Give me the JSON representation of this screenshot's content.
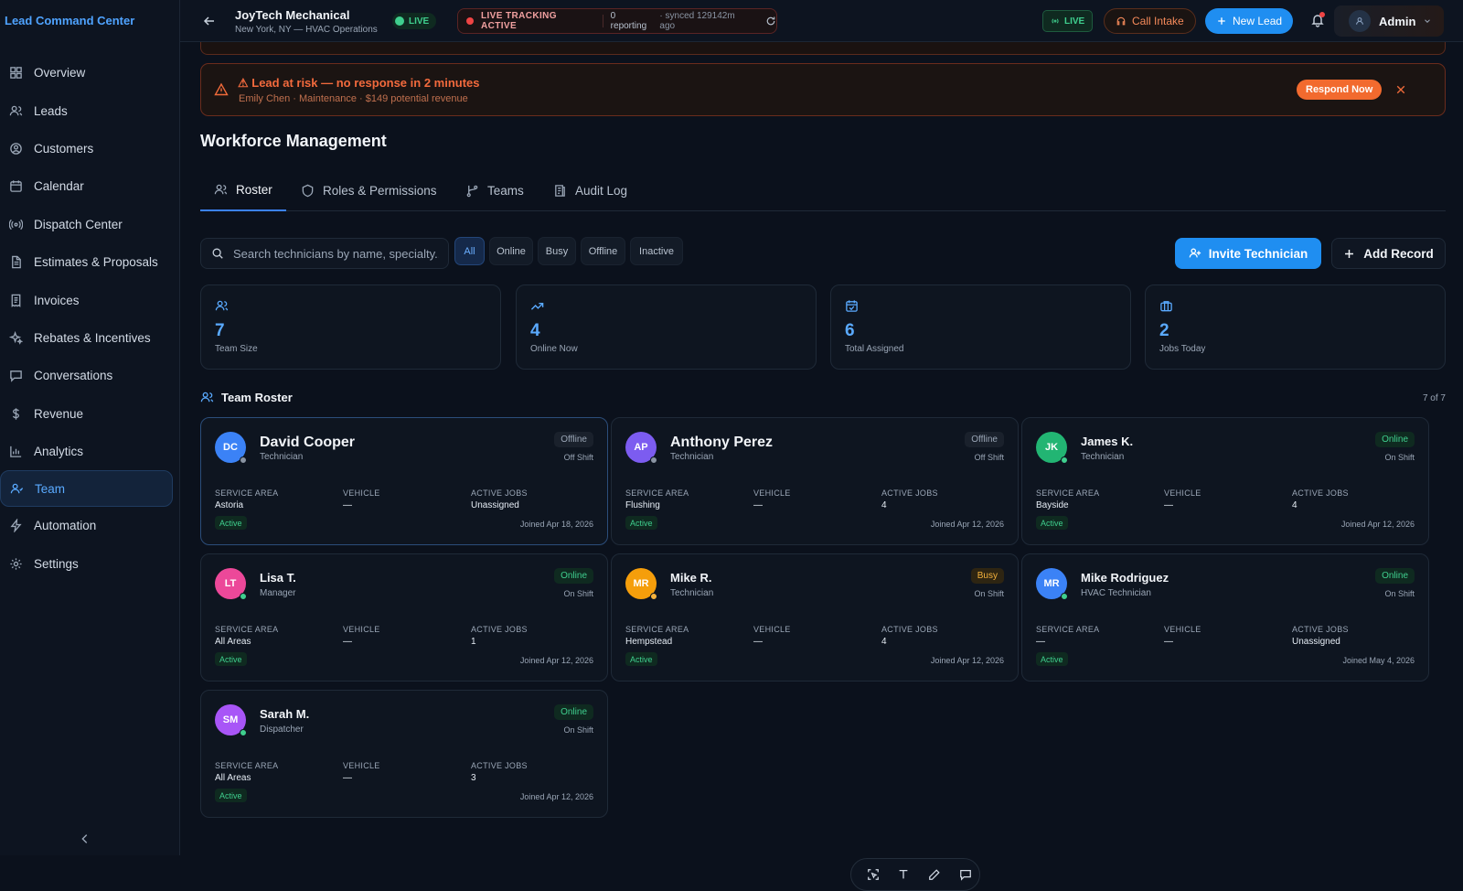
{
  "brand": "Lead Command Center",
  "nav": [
    "Overview",
    "Leads",
    "Customers",
    "Calendar",
    "Dispatch Center",
    "Estimates & Proposals",
    "Invoices",
    "Rebates & Incentives",
    "Conversations",
    "Revenue",
    "Analytics",
    "Team",
    "Automation",
    "Settings"
  ],
  "nav_icons": [
    "grid-icon",
    "users-icon",
    "user-circle-icon",
    "calendar-icon",
    "radio-icon",
    "document-icon",
    "receipt-icon",
    "sparkles-icon",
    "chat-icon",
    "dollar-icon",
    "bar-chart-icon",
    "team-icon",
    "bolt-icon",
    "gear-icon"
  ],
  "nav_active": "Team",
  "topbar": {
    "company": "JoyTech Mechanical",
    "location": "New York, NY — HVAC Operations",
    "live": "LIVE",
    "tracking": "LIVE TRACKING ACTIVE",
    "reporting": "0 reporting",
    "synced": "· synced 129142m ago",
    "live2": "LIVE",
    "call_intake": "Call Intake",
    "new_lead": "New Lead",
    "user": "Admin"
  },
  "alert": {
    "title": "⚠ Lead at risk — no response in 2 minutes",
    "detail": "Emily Chen · Maintenance · $149 potential revenue",
    "action": "Respond Now"
  },
  "page_title": "Workforce Management",
  "tabs": [
    "Roster",
    "Roles & Permissions",
    "Teams",
    "Audit Log"
  ],
  "search_placeholder": "Search technicians by name, specialty...",
  "filters": [
    "All",
    "Online",
    "Busy",
    "Offline",
    "Inactive"
  ],
  "invite_label": "Invite Technician",
  "add_label": "Add Record",
  "stats": [
    {
      "value": "7",
      "label": "Team Size",
      "icon": "users-icon"
    },
    {
      "value": "4",
      "label": "Online Now",
      "icon": "trending-up-icon"
    },
    {
      "value": "6",
      "label": "Total Assigned",
      "icon": "calendar-check-icon"
    },
    {
      "value": "2",
      "label": "Jobs Today",
      "icon": "briefcase-icon"
    }
  ],
  "roster_title": "Team Roster",
  "roster_count": "7 of 7",
  "field_labels": {
    "area": "SERVICE AREA",
    "vehicle": "VEHICLE",
    "jobs": "ACTIVE JOBS"
  },
  "members": [
    {
      "initials": "DC",
      "name": "David Cooper",
      "role": "Technician",
      "status": "Offline",
      "shift": "Off Shift",
      "area": "Astoria",
      "vehicle": "—",
      "jobs": "Unassigned",
      "badge": "Active",
      "joined": "Joined Apr 18, 2026",
      "color": "#3b82f6",
      "dot": "#8a94a3"
    },
    {
      "initials": "AP",
      "name": "Anthony Perez",
      "role": "Technician",
      "status": "Offline",
      "shift": "Off Shift",
      "area": "Flushing",
      "vehicle": "—",
      "jobs": "4",
      "badge": "Active",
      "joined": "Joined Apr 12, 2026",
      "color": "#7c5cf0",
      "dot": "#8a94a3"
    },
    {
      "initials": "JK",
      "name": "James K.",
      "role": "Technician",
      "status": "Online",
      "shift": "On Shift",
      "area": "Bayside",
      "vehicle": "—",
      "jobs": "4",
      "badge": "Active",
      "joined": "Joined Apr 12, 2026",
      "color": "#22b573",
      "dot": "#3fcf8e"
    },
    {
      "initials": "LT",
      "name": "Lisa T.",
      "role": "Manager",
      "status": "Online",
      "shift": "On Shift",
      "area": "All Areas",
      "vehicle": "—",
      "jobs": "1",
      "badge": "Active",
      "joined": "Joined Apr 12, 2026",
      "color": "#ec4899",
      "dot": "#3fcf8e"
    },
    {
      "initials": "MR",
      "name": "Mike R.",
      "role": "Technician",
      "status": "Busy",
      "shift": "On Shift",
      "area": "Hempstead",
      "vehicle": "—",
      "jobs": "4",
      "badge": "Active",
      "joined": "Joined Apr 12, 2026",
      "color": "#f59e0b",
      "dot": "#f5b23c"
    },
    {
      "initials": "MR",
      "name": "Mike Rodriguez",
      "role": "HVAC Technician",
      "status": "Online",
      "shift": "On Shift",
      "area": "—",
      "vehicle": "—",
      "jobs": "Unassigned",
      "badge": "Active",
      "joined": "Joined May 4, 2026",
      "color": "#3b82f6",
      "dot": "#3fcf8e"
    },
    {
      "initials": "SM",
      "name": "Sarah M.",
      "role": "Dispatcher",
      "status": "Online",
      "shift": "On Shift",
      "area": "All Areas",
      "vehicle": "—",
      "jobs": "3",
      "badge": "Active",
      "joined": "Joined Apr 12, 2026",
      "color": "#a855f7",
      "dot": "#3fcf8e"
    }
  ],
  "colors": {
    "accent": "#1f8ef1",
    "online": "#3fcf8e",
    "busy": "#f5b23c",
    "danger": "#f06a3a",
    "bg": "#0b111c"
  }
}
